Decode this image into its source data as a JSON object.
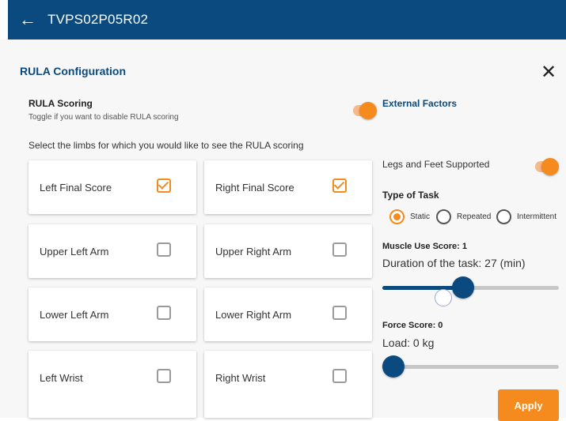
{
  "header": {
    "title": "TVPS02P05R02",
    "back_icon": "arrow-left-icon"
  },
  "dialog": {
    "heading": "RULA Configuration",
    "close_icon": "close-icon",
    "rula_scoring": {
      "title": "RULA Scoring",
      "subtitle": "Toggle if you want to disable RULA scoring",
      "enabled": true
    },
    "instruction": "Select the limbs for which you would like to see the RULA scoring",
    "limbs": [
      {
        "label": "Left Final Score",
        "checked": true
      },
      {
        "label": "Right Final Score",
        "checked": true
      },
      {
        "label": "Upper Left Arm",
        "checked": false
      },
      {
        "label": "Upper Right Arm",
        "checked": false
      },
      {
        "label": "Lower Left Arm",
        "checked": false
      },
      {
        "label": "Lower Right Arm",
        "checked": false
      },
      {
        "label": "Left Wrist",
        "checked": false
      },
      {
        "label": "Right Wrist",
        "checked": false
      }
    ],
    "external": {
      "title": "External Factors",
      "legs_label": "Legs and Feet Supported",
      "legs_enabled": true,
      "type_of_task_label": "Type of Task",
      "task_options": [
        "Static",
        "Repeated",
        "Intermittent"
      ],
      "selected_task": "Static",
      "muscle_label": "Muscle Use Score: 1",
      "duration_label": "Duration of the task: 27 (min)",
      "duration_fraction": 0.45,
      "force_label": "Force Score: 0",
      "load_label": "Load: 0 kg",
      "load_fraction": 0.0
    },
    "apply_label": "Apply"
  },
  "colors": {
    "primary": "#0b4a7e",
    "accent": "#f58a1f"
  }
}
